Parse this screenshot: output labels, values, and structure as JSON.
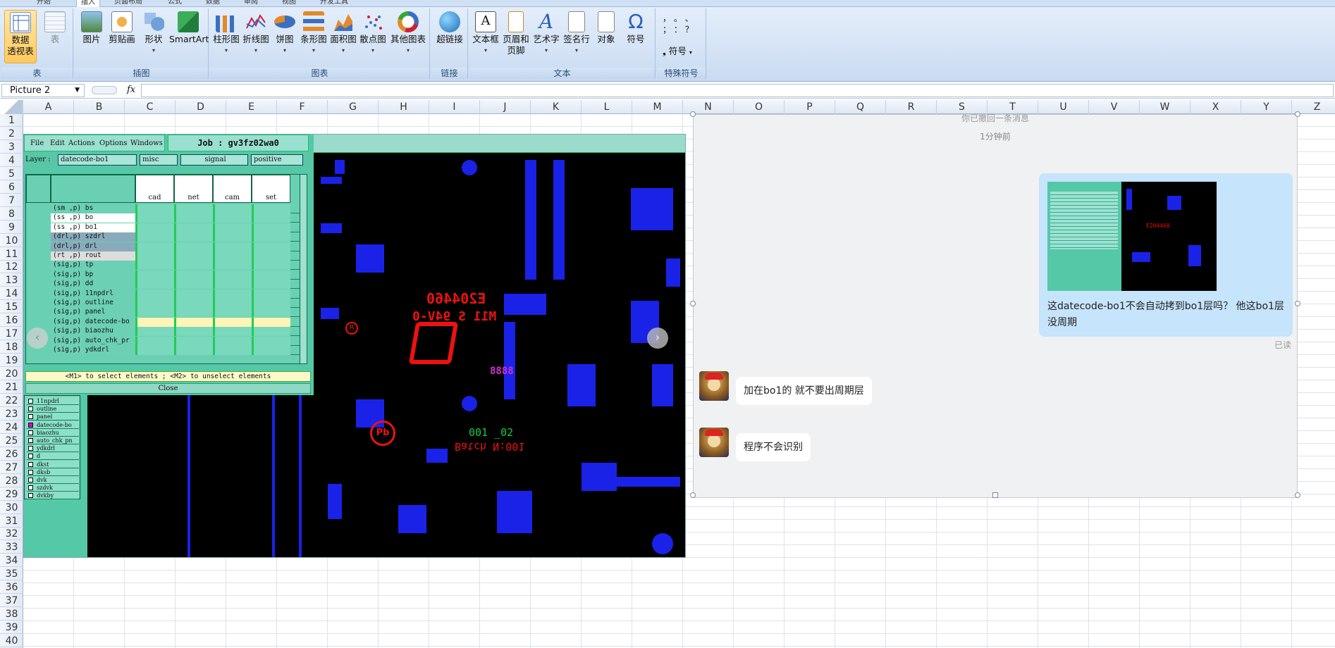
{
  "ribbon": {
    "tabs": [
      "开始",
      "插入",
      "页面布局",
      "公式",
      "数据",
      "审阅",
      "视图",
      "开发工具"
    ],
    "active_tab": "插入",
    "groups": [
      {
        "label": "表",
        "buttons": [
          {
            "label": "数据\n透视表",
            "icon": "pivot-table-icon"
          },
          {
            "label": "表",
            "icon": "table-icon"
          }
        ]
      },
      {
        "label": "插图",
        "buttons": [
          {
            "label": "图片",
            "icon": "picture-icon"
          },
          {
            "label": "剪贴画",
            "icon": "clipart-icon"
          },
          {
            "label": "形状",
            "icon": "shapes-icon"
          },
          {
            "label": "SmartArt",
            "icon": "smartart-icon"
          }
        ]
      },
      {
        "label": "图表",
        "buttons": [
          {
            "label": "柱形图",
            "icon": "column-chart-icon"
          },
          {
            "label": "折线图",
            "icon": "line-chart-icon"
          },
          {
            "label": "饼图",
            "icon": "pie-chart-icon"
          },
          {
            "label": "条形图",
            "icon": "bar-chart-icon"
          },
          {
            "label": "面积图",
            "icon": "area-chart-icon"
          },
          {
            "label": "散点图",
            "icon": "scatter-chart-icon"
          },
          {
            "label": "其他图表",
            "icon": "other-chart-icon"
          }
        ]
      },
      {
        "label": "链接",
        "buttons": [
          {
            "label": "超链接",
            "icon": "hyperlink-icon"
          }
        ]
      },
      {
        "label": "文本",
        "buttons": [
          {
            "label": "文本框",
            "icon": "textbox-icon"
          },
          {
            "label": "页眉和\n页脚",
            "icon": "header-footer-icon"
          },
          {
            "label": "艺术字",
            "icon": "wordart-icon"
          },
          {
            "label": "签名行",
            "icon": "signature-icon"
          },
          {
            "label": "对象",
            "icon": "object-icon"
          },
          {
            "label": "符号",
            "icon": "omega-icon"
          }
        ]
      },
      {
        "label": "特殊符号",
        "buttons": [
          {
            "label": "符号",
            "icon": "special-symbol-icon"
          }
        ]
      }
    ],
    "special_symbols": [
      "，",
      "。",
      "、",
      "；",
      "：",
      "？"
    ]
  },
  "formula_bar": {
    "name_box": "Picture 2",
    "fx": "fx",
    "value": ""
  },
  "columns": [
    "A",
    "B",
    "C",
    "D",
    "E",
    "F",
    "G",
    "H",
    "I",
    "J",
    "K",
    "L",
    "M",
    "N",
    "O",
    "P",
    "Q",
    "R",
    "S",
    "T",
    "U",
    "V",
    "W",
    "X",
    "Y",
    "Z"
  ],
  "rows": [
    "1",
    "2",
    "3",
    "4",
    "5",
    "6",
    "7",
    "8",
    "9",
    "10",
    "11",
    "12",
    "13",
    "14",
    "15",
    "16",
    "17",
    "18",
    "19",
    "20",
    "21",
    "22",
    "23",
    "24",
    "25",
    "26",
    "27",
    "28",
    "29",
    "30",
    "31",
    "32",
    "33",
    "34",
    "35",
    "36",
    "37",
    "38",
    "39",
    "40"
  ],
  "cam": {
    "menu": [
      "File",
      "Edit",
      "Actions",
      "Options",
      "Windows"
    ],
    "job": "Job : gv3fz02wa0",
    "layer_label": "Layer :",
    "layer_value": "datecode-bo1",
    "dropdowns": [
      "misc",
      "signal",
      "positive"
    ],
    "matrix_headers": [
      "cad",
      "net",
      "cam",
      "set"
    ],
    "matrix_rows": [
      "(sm ,p) bs",
      "(ss ,p) bo",
      "(ss ,p) bo1",
      "(drl,p) szdrl",
      "(drl,p) drl",
      "(rt ,p) rout",
      "(sig,p) tp",
      "(sig,p) bp",
      "(sig,p) dd",
      "(sig,p) 11npdrl",
      "(sig,p) outline",
      "(sig,p) panel",
      "(sig,p) datecode-bo",
      "(sig,p) biaozhu",
      "(sig,p) auto_chk_pr",
      "(sig,p) ydkdrl"
    ],
    "hint": "<M1> to select elements ; <M2> to unselect elements",
    "close": "Close",
    "layer_list": [
      "11npdrl",
      "outline",
      "panel",
      "datecode-bo",
      "biaozhu",
      "auto_chk_pn",
      "ydkdrl",
      "d",
      "dkst",
      "dksb",
      "dvk",
      "szdvk",
      "dvkby"
    ],
    "board_text": {
      "code1": "E204460",
      "code2": "M11 S 94V-0",
      "digits": "8888",
      "date": "001   _02",
      "batch": "Batch N:001"
    },
    "prev_arrow": "‹",
    "next_arrow": "›"
  },
  "chat": {
    "top_note": "你已撤回一条消息",
    "time": "1分钟前",
    "my_message": "这datecode-bo1不会自动拷到bo1层吗？ 他这bo1层没周期",
    "read_status": "已读",
    "replies": [
      "加在bo1的 就不要出周期层",
      "程序不会识别"
    ]
  }
}
